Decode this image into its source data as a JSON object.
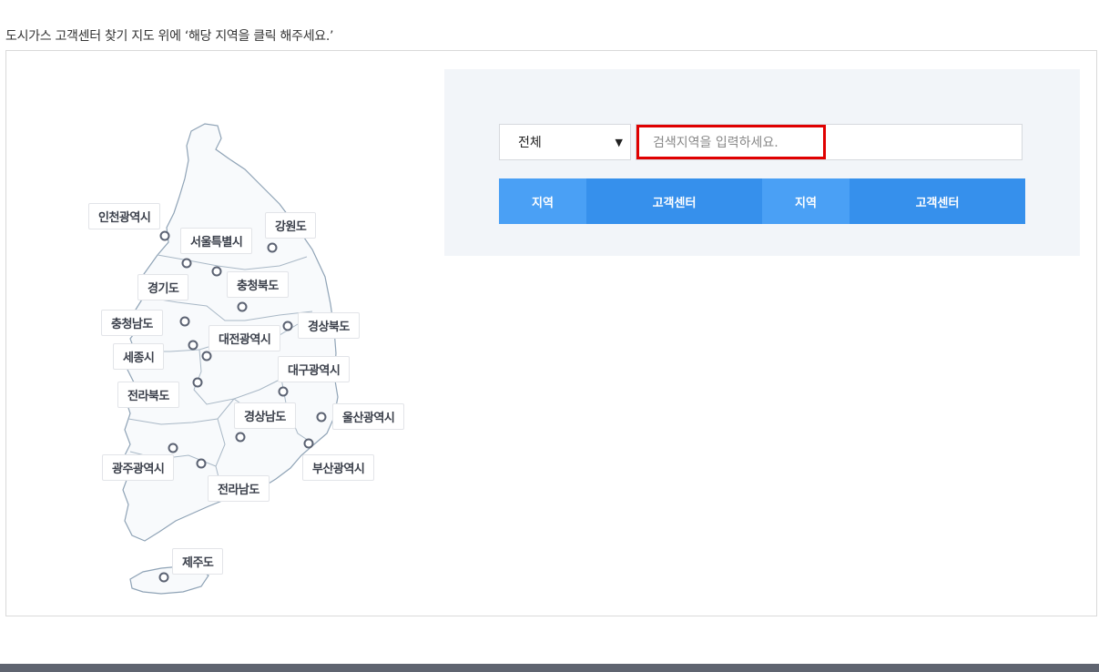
{
  "intro": "도시가스 고객센터 찾기 지도 위에 ‘해당 지역을 클릭 해주세요.’",
  "map": {
    "regions": [
      {
        "id": "incheon",
        "label": "인천광역시"
      },
      {
        "id": "seoul",
        "label": "서울특별시"
      },
      {
        "id": "gangwon",
        "label": "강원도"
      },
      {
        "id": "gyeonggi",
        "label": "경기도"
      },
      {
        "id": "chungbuk",
        "label": "충청북도"
      },
      {
        "id": "chungnam",
        "label": "충청남도"
      },
      {
        "id": "gyeongbuk",
        "label": "경상북도"
      },
      {
        "id": "daejeon",
        "label": "대전광역시"
      },
      {
        "id": "sejong",
        "label": "세종시"
      },
      {
        "id": "daegu",
        "label": "대구광역시"
      },
      {
        "id": "jeonbuk",
        "label": "전라북도"
      },
      {
        "id": "gyeongnam",
        "label": "경상남도"
      },
      {
        "id": "ulsan",
        "label": "울산광역시"
      },
      {
        "id": "gwangju",
        "label": "광주광역시"
      },
      {
        "id": "busan",
        "label": "부산광역시"
      },
      {
        "id": "jeonnam",
        "label": "전라남도"
      },
      {
        "id": "jeju",
        "label": "제주도"
      }
    ]
  },
  "search": {
    "select_value": "전체",
    "input_placeholder": "검색지역을 입력하세요.",
    "columns": [
      "지역",
      "고객센터",
      "지역",
      "고객센터"
    ]
  },
  "colors": {
    "accent": "#3690ec",
    "accent_light": "#4aa0f5",
    "highlight": "#e00000",
    "footer": "#5f6470"
  }
}
